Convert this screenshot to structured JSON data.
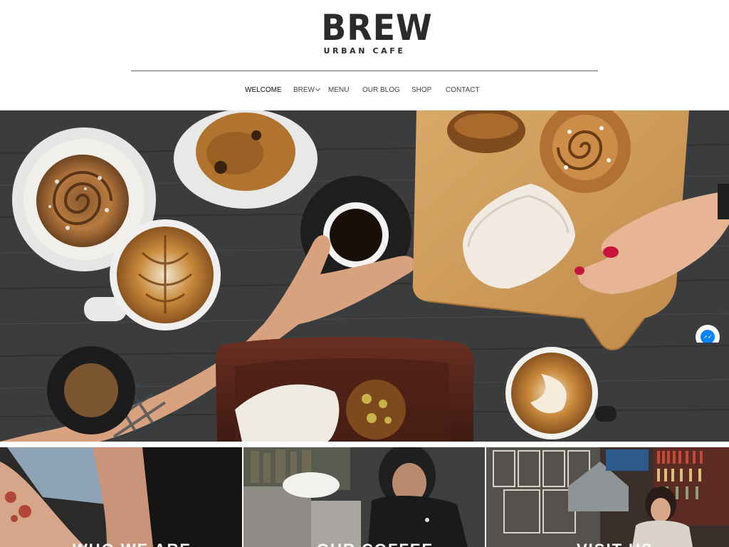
{
  "brand": {
    "name": "BREW",
    "tagline": "URBAN CAFE"
  },
  "nav": {
    "items": [
      {
        "label": "WELCOME",
        "active": true
      },
      {
        "label": "BREW",
        "has_submenu": true
      },
      {
        "label": "MENU"
      },
      {
        "label": "OUR BLOG"
      },
      {
        "label": "SHOP"
      },
      {
        "label": "CONTACT"
      }
    ]
  },
  "hero": {
    "image": "overhead-coffee-and-pastries"
  },
  "messenger": {
    "icon": "messenger-icon",
    "color": "#0084ff"
  },
  "tiles": [
    {
      "title": "WHO WE ARE",
      "image": "barista-tattooed-arm"
    },
    {
      "title": "OUR COFFEE",
      "image": "barista-at-espresso-machine"
    },
    {
      "title": "VISIT US",
      "image": "cafe-interior-bookshelves"
    }
  ],
  "colors": {
    "text": "#2b2b2b",
    "nav_text": "#444444",
    "hero_table": "#3c3e40"
  }
}
